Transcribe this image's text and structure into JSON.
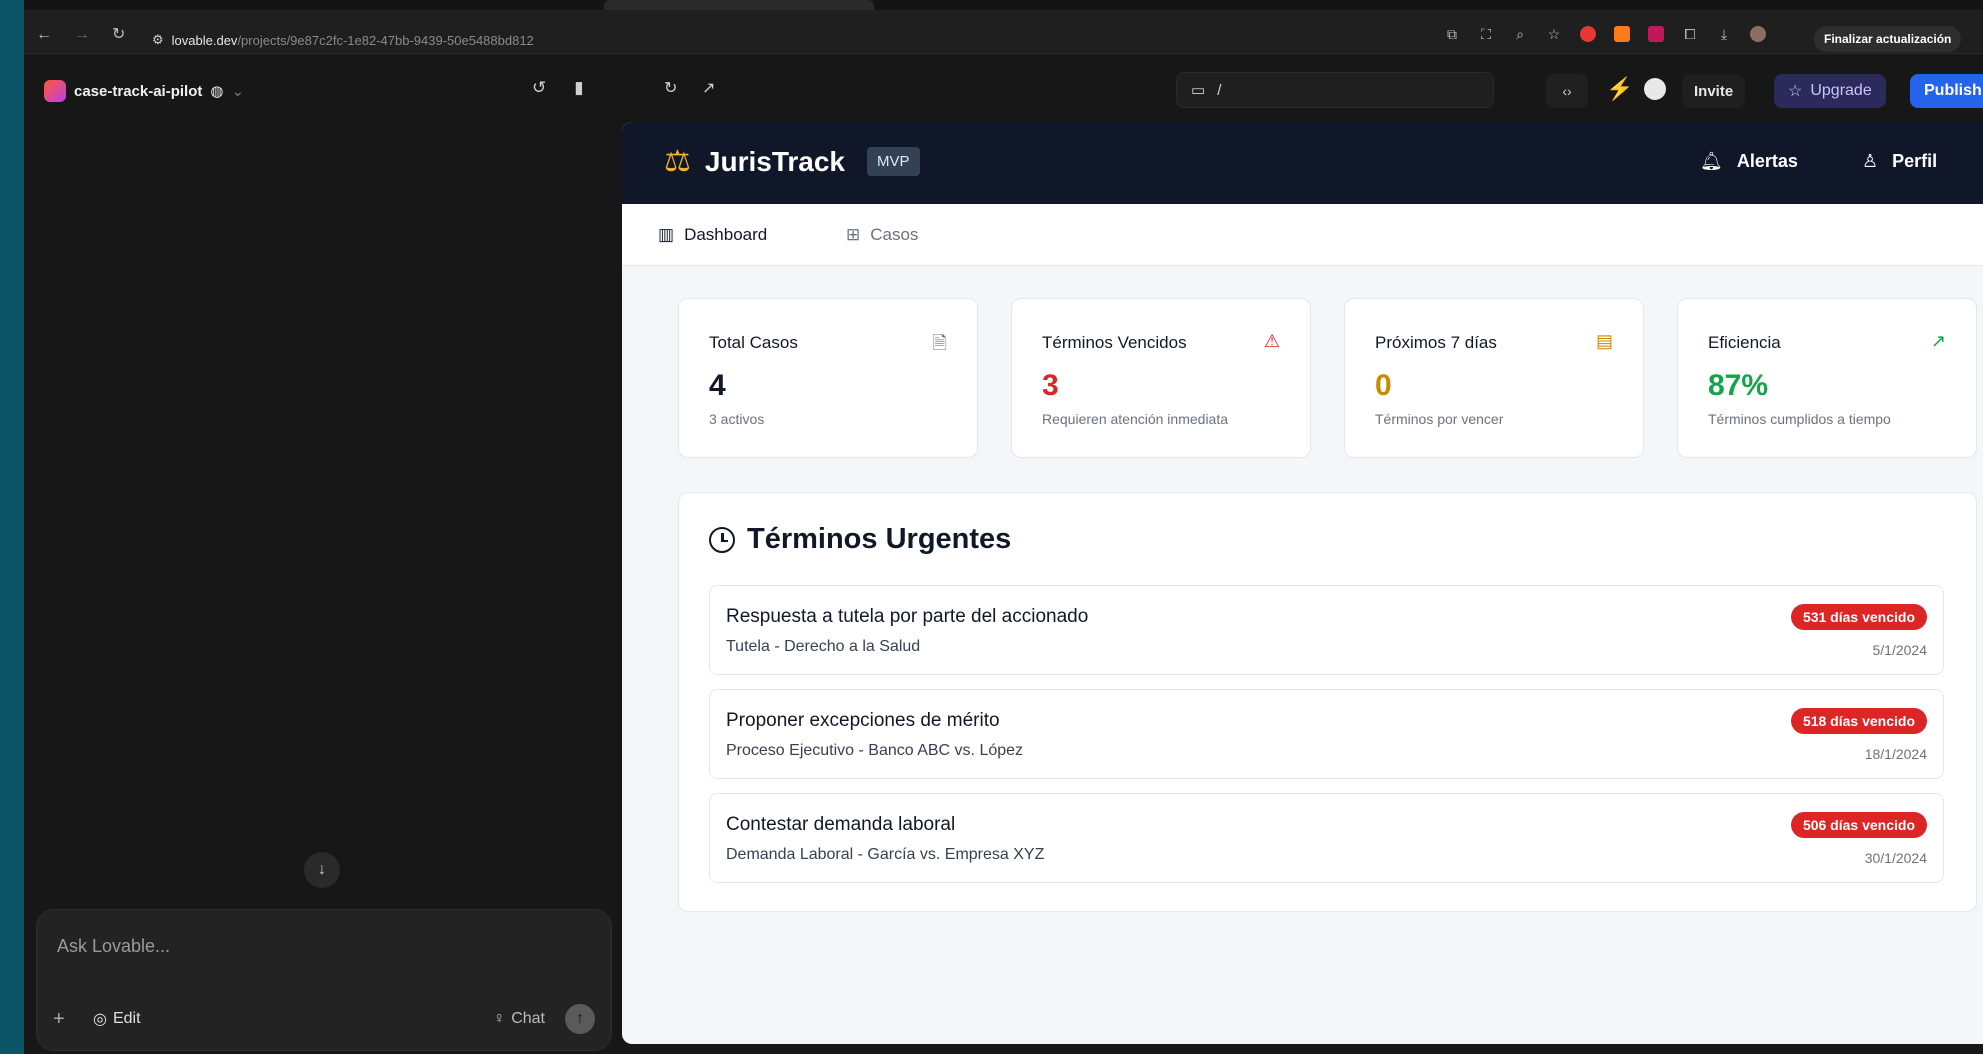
{
  "browser": {
    "url_host": "lovable.dev",
    "url_path": "/projects/9e87c2fc-1e82-47bb-9439-50e5488bd812",
    "finish_update_label": "Finalizar actualización"
  },
  "lovable": {
    "project_name": "case-track-ai-pilot",
    "chat_placeholder": "Ask Lovable...",
    "edit_label": "Edit",
    "chat_label": "Chat",
    "route": "/",
    "invite_label": "Invite",
    "upgrade_label": "Upgrade",
    "publish_label": "Publish"
  },
  "app": {
    "brand": "JurisTrack",
    "badge": "MVP",
    "alerts_label": "Alertas",
    "profile_label": "Perfil",
    "nav": [
      {
        "label": "Dashboard"
      },
      {
        "label": "Casos"
      }
    ],
    "stats": [
      {
        "title": "Total Casos",
        "value": "4",
        "sub": "3 activos",
        "icon": "document-icon",
        "color": "#111827"
      },
      {
        "title": "Términos Vencidos",
        "value": "3",
        "sub": "Requieren atención inmediata",
        "icon": "alert-triangle-icon",
        "color": "#dc2626"
      },
      {
        "title": "Próximos 7 días",
        "value": "0",
        "sub": "Términos por vencer",
        "icon": "calendar-icon",
        "color": "#ca8a04"
      },
      {
        "title": "Eficiencia",
        "value": "87%",
        "sub": "Términos cumplidos a tiempo",
        "icon": "trending-up-icon",
        "color": "#16a34a"
      }
    ],
    "urgent": {
      "title": "Términos Urgentes",
      "items": [
        {
          "name": "Respuesta a tutela por parte del accionado",
          "case": "Tutela - Derecho a la Salud",
          "badge": "531 días vencido",
          "date": "5/1/2024"
        },
        {
          "name": "Proponer excepciones de mérito",
          "case": "Proceso Ejecutivo - Banco ABC vs. López",
          "badge": "518 días vencido",
          "date": "18/1/2024"
        },
        {
          "name": "Contestar demanda laboral",
          "case": "Demanda Laboral - García vs. Empresa XYZ",
          "badge": "506 días vencido",
          "date": "30/1/2024"
        }
      ]
    }
  }
}
